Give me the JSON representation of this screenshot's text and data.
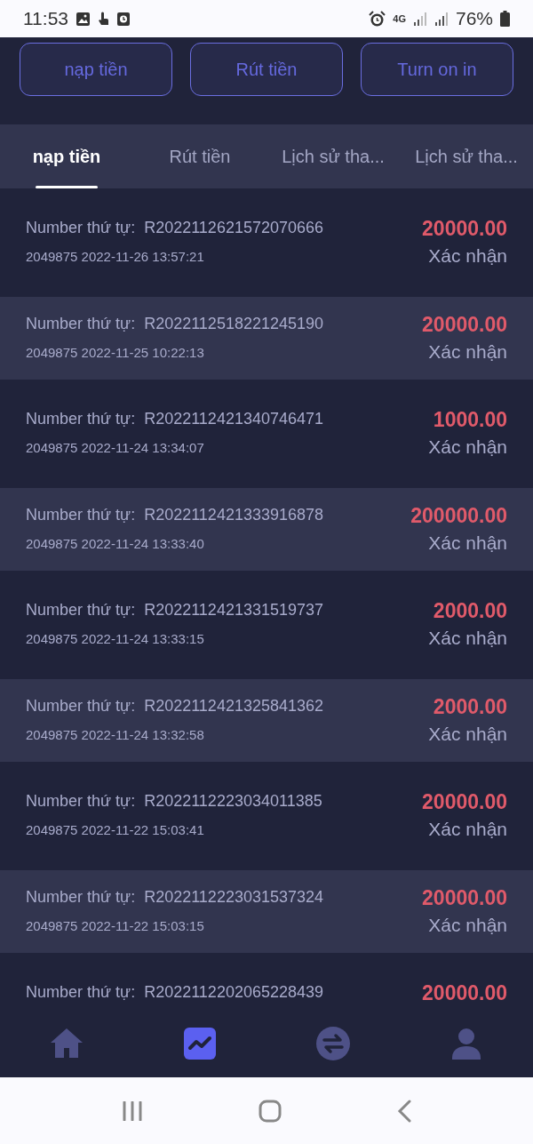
{
  "status_bar": {
    "time": "11:53",
    "network": "4G",
    "battery": "76%"
  },
  "action_buttons": [
    "nạp tiền",
    "Rút tiền",
    "Turn on in"
  ],
  "tabs": [
    {
      "label": "nạp tiền",
      "selected": true
    },
    {
      "label": "Rút tiền",
      "selected": false
    },
    {
      "label": "Lịch sử tha...",
      "selected": false
    },
    {
      "label": "Lịch sử tha...",
      "selected": false
    }
  ],
  "transactions": [
    {
      "label": "Number thứ tự:",
      "order": "R2022112621572070666",
      "details": "2049875 2022-11-26 13:57:21",
      "amount": "20000.00",
      "status": "Xác nhận"
    },
    {
      "label": "Number thứ tự:",
      "order": "R2022112518221245190",
      "details": "2049875 2022-11-25 10:22:13",
      "amount": "20000.00",
      "status": "Xác nhận"
    },
    {
      "label": "Number thứ tự:",
      "order": "R2022112421340746471",
      "details": "2049875 2022-11-24 13:34:07",
      "amount": "1000.00",
      "status": "Xác nhận"
    },
    {
      "label": "Number thứ tự:",
      "order": "R2022112421333916878",
      "details": "2049875 2022-11-24 13:33:40",
      "amount": "200000.00",
      "status": "Xác nhận"
    },
    {
      "label": "Number thứ tự:",
      "order": "R2022112421331519737",
      "details": "2049875 2022-11-24 13:33:15",
      "amount": "2000.00",
      "status": "Xác nhận"
    },
    {
      "label": "Number thứ tự:",
      "order": "R2022112421325841362",
      "details": "2049875 2022-11-24 13:32:58",
      "amount": "2000.00",
      "status": "Xác nhận"
    },
    {
      "label": "Number thứ tự:",
      "order": "R2022112223034011385",
      "details": "2049875 2022-11-22 15:03:41",
      "amount": "20000.00",
      "status": "Xác nhận"
    },
    {
      "label": "Number thứ tự:",
      "order": "R2022112223031537324",
      "details": "2049875 2022-11-22 15:03:15",
      "amount": "20000.00",
      "status": "Xác nhận"
    },
    {
      "label": "Number thứ tự:",
      "order": "R2022112202065228439",
      "amount": "20000.00"
    }
  ],
  "bottom_nav": [
    {
      "kind": "home",
      "selected": false
    },
    {
      "kind": "chart",
      "selected": true
    },
    {
      "kind": "exchange",
      "selected": false
    },
    {
      "kind": "profile",
      "selected": false
    }
  ]
}
